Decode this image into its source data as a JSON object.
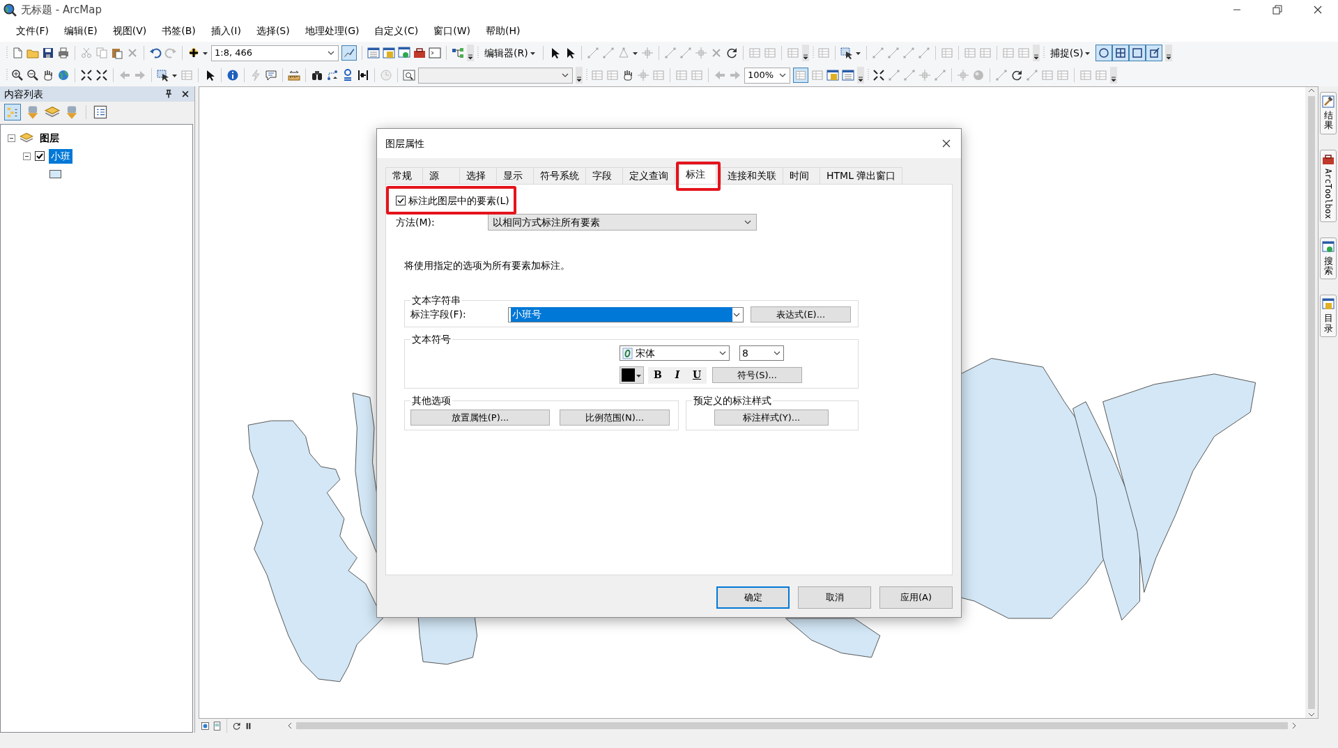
{
  "window": {
    "title": "无标题 - ArcMap"
  },
  "menu": [
    "文件(F)",
    "编辑(E)",
    "视图(V)",
    "书签(B)",
    "插入(I)",
    "选择(S)",
    "地理处理(G)",
    "自定义(C)",
    "窗口(W)",
    "帮助(H)"
  ],
  "toolbar": {
    "scale": "1:8, 466",
    "editor_menu": "编辑器(R)",
    "zoom_percent": "100%",
    "snapping_menu": "捕捉(S)",
    "snap_types": [
      {
        "on": true
      },
      {
        "on": true
      },
      {
        "on": true
      },
      {
        "on": true
      }
    ]
  },
  "toc": {
    "title": "内容列表",
    "tree": [
      {
        "label": "图层",
        "expanded": true,
        "children": [
          {
            "label": "小班",
            "checked": true,
            "selected": true,
            "expanded": true
          }
        ]
      }
    ]
  },
  "side_tabs": [
    "结果",
    "ArcToolbox",
    "搜索",
    "目录"
  ],
  "dialog": {
    "title": "图层属性",
    "tabs": [
      {
        "label": "常规",
        "selected": false,
        "highlighted": false
      },
      {
        "label": "源",
        "selected": false,
        "highlighted": false
      },
      {
        "label": "选择",
        "selected": false,
        "highlighted": false
      },
      {
        "label": "显示",
        "selected": false,
        "highlighted": false
      },
      {
        "label": "符号系统",
        "selected": false,
        "highlighted": false
      },
      {
        "label": "字段",
        "selected": false,
        "highlighted": false
      },
      {
        "label": "定义查询",
        "selected": false,
        "highlighted": false
      },
      {
        "label": "标注",
        "selected": true,
        "highlighted": true
      },
      {
        "label": "连接和关联",
        "selected": false,
        "highlighted": false
      },
      {
        "label": "时间",
        "selected": false,
        "highlighted": false
      },
      {
        "label": "HTML 弹出窗口",
        "selected": false,
        "highlighted": false
      }
    ],
    "label_features": {
      "label": "标注此图层中的要素(L)",
      "checked": true,
      "highlighted": true
    },
    "method": {
      "label": "方法(M):",
      "value": "以相同方式标注所有要素"
    },
    "info": "将使用指定的选项为所有要素加标注。",
    "text_string": {
      "title": "文本字符串",
      "field_label": "标注字段(F):",
      "field_value": "小班号",
      "value_selected": true,
      "expression_button": "表达式(E)..."
    },
    "text_symbol": {
      "title": "文本符号",
      "font": "宋体",
      "size": "8",
      "color": "#000000",
      "style_buttons": [
        {
          "label": "B",
          "kind": "bold",
          "on": false
        },
        {
          "label": "I",
          "kind": "italic",
          "on": false
        },
        {
          "label": "U",
          "kind": "underline",
          "on": false
        }
      ],
      "symbol_button": "符号(S)..."
    },
    "other_options": {
      "title": "其他选项",
      "buttons": [
        "放置属性(P)...",
        "比例范围(N)..."
      ]
    },
    "predefined": {
      "title": "预定义的标注样式",
      "button": "标注样式(Y)..."
    },
    "buttons": [
      {
        "label": "确定",
        "default": true
      },
      {
        "label": "取消",
        "default": false
      },
      {
        "label": "应用(A)",
        "default": false
      }
    ]
  }
}
